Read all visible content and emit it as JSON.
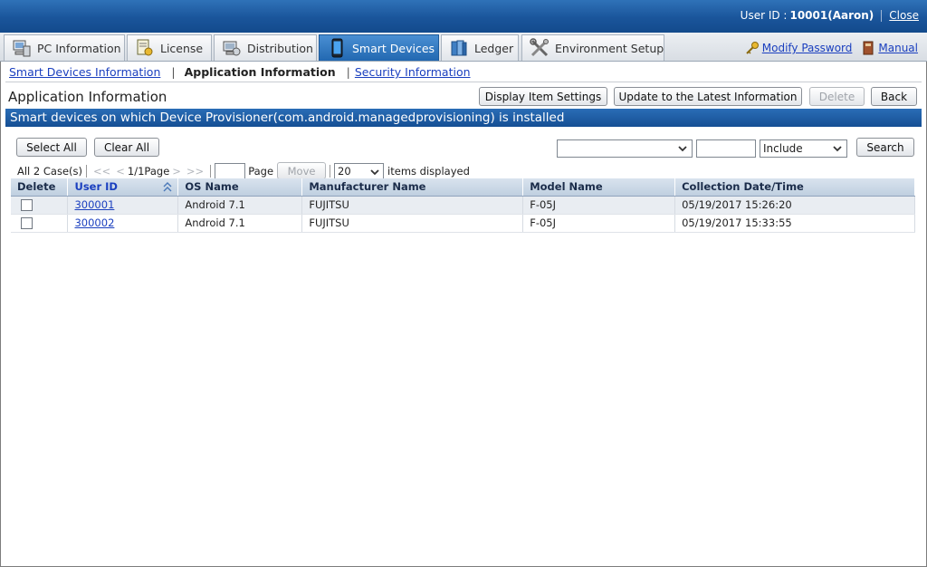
{
  "header": {
    "user_label": "User ID :",
    "user_value": "10001(Aaron)",
    "close_label": "Close"
  },
  "tabs": [
    {
      "label": "PC Information",
      "icon": "pc-icon"
    },
    {
      "label": "License",
      "icon": "license-icon"
    },
    {
      "label": "Distribution",
      "icon": "distribution-icon"
    },
    {
      "label": "Smart Devices",
      "icon": "smartphone-icon",
      "active": true
    },
    {
      "label": "Ledger",
      "icon": "ledger-icon"
    },
    {
      "label": "Environment Setup",
      "icon": "tools-icon"
    }
  ],
  "top_links": {
    "modify_password": "Modify Password",
    "manual": "Manual"
  },
  "subnav": {
    "item1": "Smart Devices Information",
    "item2": "Application Information",
    "item3": "Security Information"
  },
  "page": {
    "title": "Application Information",
    "btn_display_item_settings": "Display Item Settings",
    "btn_update": "Update to the Latest Information",
    "btn_delete": "Delete",
    "btn_back": "Back"
  },
  "section": {
    "title": "Smart devices on which Device Provisioner(com.android.managedprovisioning) is installed"
  },
  "filter": {
    "select_all": "Select All",
    "clear_all": "Clear All",
    "field_select_value": "",
    "search_text_value": "",
    "condition_value": "Include",
    "search_button": "Search"
  },
  "pager": {
    "total": "All 2 Case(s)",
    "first": "<<",
    "prev": "<",
    "page_info": "1/1Page",
    "next": ">",
    "last": ">>",
    "page_input_value": "",
    "page_label": "Page",
    "move_button": "Move",
    "per_page_value": "20",
    "items_displayed": "items displayed"
  },
  "table": {
    "columns": [
      "Delete",
      "User ID",
      "OS Name",
      "Manufacturer Name",
      "Model Name",
      "Collection Date/Time"
    ],
    "rows": [
      {
        "user_id": "300001",
        "os": "Android 7.1",
        "manufacturer": "FUJITSU",
        "model": "F-05J",
        "collected": "05/19/2017 15:26:20"
      },
      {
        "user_id": "300002",
        "os": "Android 7.1",
        "manufacturer": "FUJITSU",
        "model": "F-05J",
        "collected": "05/19/2017 15:33:55"
      }
    ]
  },
  "colors": {
    "header_blue": "#1a559b",
    "active_tab": "#2268b1",
    "link": "#1a3fbf",
    "table_header": "#c9d7e6"
  }
}
